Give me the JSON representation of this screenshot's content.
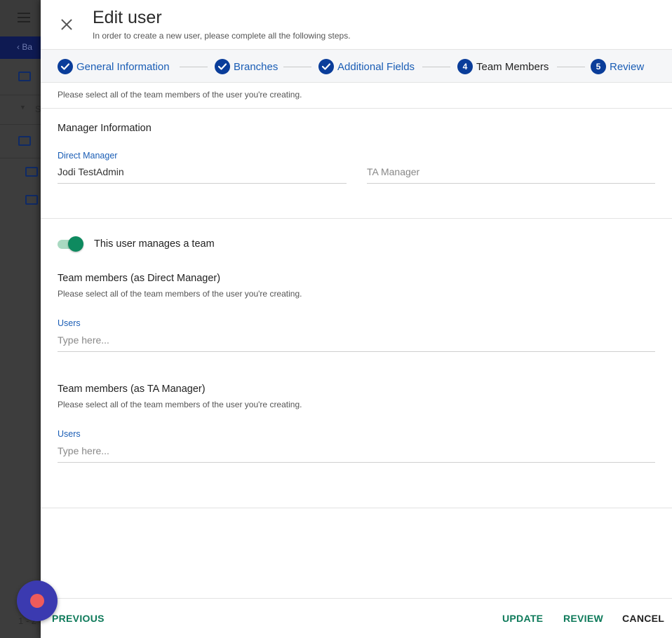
{
  "header": {
    "title": "Edit user",
    "subtitle": "In order to create a new user, please complete all the following steps."
  },
  "stepper": {
    "steps": [
      {
        "number": "1",
        "label": "General Information",
        "state": "completed"
      },
      {
        "number": "2",
        "label": "Branches",
        "state": "completed"
      },
      {
        "number": "3",
        "label": "Additional Fields",
        "state": "completed"
      },
      {
        "number": "4",
        "label": "Team Members",
        "state": "active"
      },
      {
        "number": "5",
        "label": "Review",
        "state": "upcoming"
      }
    ]
  },
  "intro_hint": "Please select all of the team members of the user you're creating.",
  "manager_info": {
    "title": "Manager Information",
    "direct_manager_label": "Direct Manager",
    "direct_manager_value": "Jodi TestAdmin",
    "ta_manager_placeholder": "TA Manager"
  },
  "team": {
    "toggle_label": "This user manages a team",
    "toggle_on": true,
    "direct": {
      "title": "Team members (as Direct Manager)",
      "hint": "Please select all of the team members of the user you're creating.",
      "users_label": "Users",
      "placeholder": "Type here..."
    },
    "ta": {
      "title": "Team members (as TA Manager)",
      "hint": "Please select all of the team members of the user you're creating.",
      "users_label": "Users",
      "placeholder": "Type here..."
    }
  },
  "footer": {
    "previous": "PREVIOUS",
    "update": "UPDATE",
    "review": "REVIEW",
    "cancel": "CANCEL"
  },
  "background": {
    "back_label": "Ba",
    "row_fragment": "S",
    "pager_fragment": "1 - 2"
  },
  "colors": {
    "primary": "#0a3d9a",
    "link": "#1a5db5",
    "accent_green": "#0e7a5a",
    "toggle_knob": "#0e8a5f",
    "fab": "#3b3ab0",
    "fab_dot": "#ef5b5b"
  },
  "icons": {
    "close": "close-icon",
    "check": "check-icon",
    "menu": "hamburger-icon",
    "folder": "folder-icon"
  }
}
